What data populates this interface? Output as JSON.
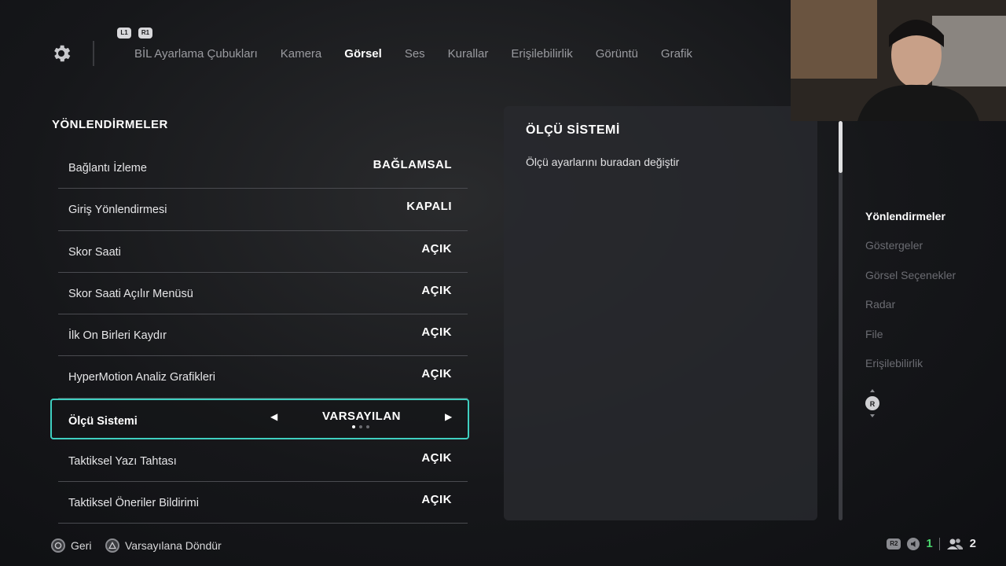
{
  "header": {
    "bumpers": {
      "left": "L1",
      "right": "R1"
    },
    "tabs": [
      {
        "label": "BİL Ayarlama Çubukları",
        "active": false
      },
      {
        "label": "Kamera",
        "active": false
      },
      {
        "label": "Görsel",
        "active": true
      },
      {
        "label": "Ses",
        "active": false
      },
      {
        "label": "Kurallar",
        "active": false
      },
      {
        "label": "Erişilebilirlik",
        "active": false
      },
      {
        "label": "Görüntü",
        "active": false
      },
      {
        "label": "Grafik",
        "active": false
      }
    ]
  },
  "section": {
    "title": "YÖNLENDİRMELER",
    "rows": [
      {
        "label": "Bağlantı İzleme",
        "value": "BAĞLAMSAL"
      },
      {
        "label": "Giriş Yönlendirmesi",
        "value": "KAPALI"
      },
      {
        "label": "Skor Saati",
        "value": "AÇIK"
      },
      {
        "label": "Skor Saati Açılır Menüsü",
        "value": "AÇIK"
      },
      {
        "label": "İlk On Birleri Kaydır",
        "value": "AÇIK"
      },
      {
        "label": "HyperMotion Analiz Grafikleri",
        "value": "AÇIK"
      },
      {
        "label": "Ölçü Sistemi",
        "value": "VARSAYILAN",
        "selected": true
      },
      {
        "label": "Taktiksel Yazı Tahtası",
        "value": "AÇIK"
      },
      {
        "label": "Taktiksel Öneriler Bildirimi",
        "value": "AÇIK"
      }
    ],
    "selected_option_index": 0,
    "selected_option_count": 3
  },
  "description": {
    "title": "ÖLÇÜ SİSTEMİ",
    "text": "Ölçü ayarlarını buradan değiştir"
  },
  "right_nav": {
    "items": [
      {
        "label": "Yönlendirmeler",
        "active": true
      },
      {
        "label": "Göstergeler",
        "active": false
      },
      {
        "label": "Görsel Seçenekler",
        "active": false
      },
      {
        "label": "Radar",
        "active": false
      },
      {
        "label": "File",
        "active": false
      },
      {
        "label": "Erişilebilirlik",
        "active": false
      }
    ],
    "stick_label": "R"
  },
  "footer": {
    "back_label": "Geri",
    "reset_label": "Varsayılana Döndür",
    "r2_label": "R2",
    "team_count": "1",
    "players_count": "2"
  },
  "colors": {
    "accent": "#3fcfc0",
    "green": "#4ad66d"
  }
}
